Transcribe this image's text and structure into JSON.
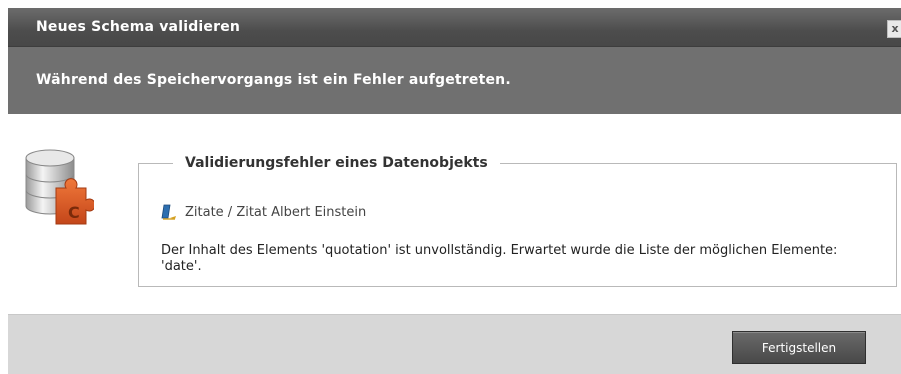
{
  "dialog": {
    "title": "Neues Schema validieren",
    "close_label": "x",
    "banner_message": "Während des Speichervorgangs ist ein Fehler aufgetreten."
  },
  "group": {
    "legend": "Validierungsfehler eines Datenobjekts",
    "entry_path": "Zitate / Zitat Albert Einstein",
    "error_message": "Der Inhalt des Elements 'quotation' ist unvollständig. Erwartet wurde die Liste der möglichen Elemente: 'date'."
  },
  "icons": {
    "main": "database-puzzle-icon",
    "entry": "document-pen-icon",
    "close": "close-icon"
  },
  "footer": {
    "finish_label": "Fertigstellen"
  },
  "colors": {
    "titlebar": "#4d4d4d",
    "banner": "#707070",
    "footer": "#d7d7d7",
    "puzzle_accent": "#e05a22"
  }
}
